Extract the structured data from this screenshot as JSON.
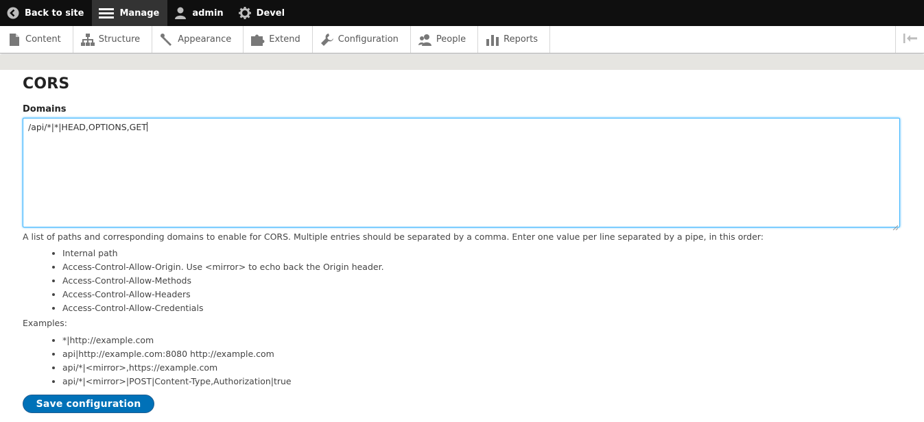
{
  "topbar": {
    "back_label": "Back to site",
    "manage_label": "Manage",
    "user_label": "admin",
    "devel_label": "Devel"
  },
  "tray": {
    "items": [
      {
        "label": "Content",
        "icon": "file-icon"
      },
      {
        "label": "Structure",
        "icon": "sitemap-icon"
      },
      {
        "label": "Appearance",
        "icon": "paintbrush-icon"
      },
      {
        "label": "Extend",
        "icon": "puzzle-icon"
      },
      {
        "label": "Configuration",
        "icon": "wrench-icon"
      },
      {
        "label": "People",
        "icon": "people-icon"
      },
      {
        "label": "Reports",
        "icon": "bar-chart-icon"
      }
    ]
  },
  "page": {
    "title": "CORS",
    "field_label": "Domains",
    "field_value": "/api/*|*|HEAD,OPTIONS,GET",
    "description": "A list of paths and corresponding domains to enable for CORS. Multiple entries should be separated by a comma. Enter one value per line separated by a pipe, in this order:",
    "order_items": [
      "Internal path",
      "Access-Control-Allow-Origin. Use <mirror> to echo back the Origin header.",
      "Access-Control-Allow-Methods",
      "Access-Control-Allow-Headers",
      "Access-Control-Allow-Credentials"
    ],
    "examples_label": "Examples:",
    "examples": [
      "*|http://example.com",
      "api|http://example.com:8080 http://example.com",
      "api/*|<mirror>,https://example.com",
      "api/*|<mirror>|POST|Content-Type,Authorization|true"
    ],
    "save_label": "Save configuration"
  },
  "colors": {
    "accent": "#0071b8",
    "focus": "#40b6ff",
    "toolbar_bg": "#0f0f0f"
  }
}
